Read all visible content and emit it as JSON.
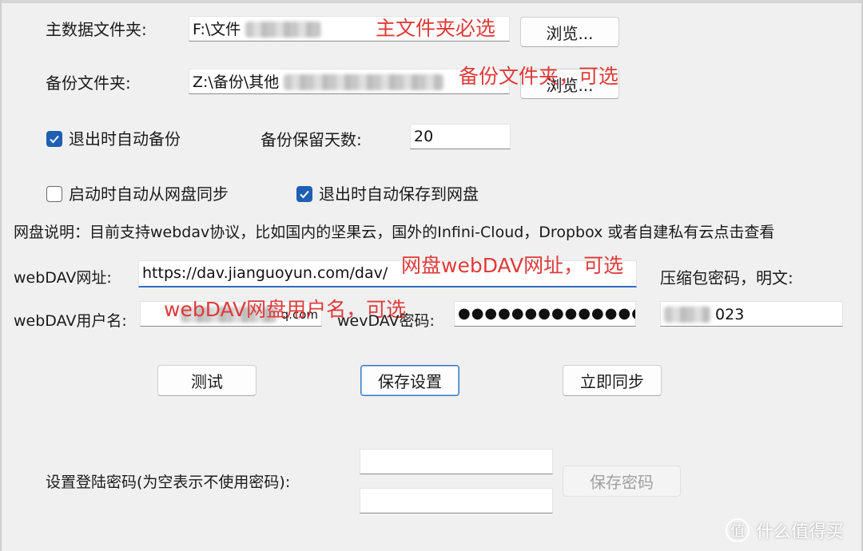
{
  "main_folder": {
    "label": "主数据文件夹:",
    "value_prefix": "F:\\文件",
    "browse_label": "浏览...",
    "annotation": "主文件夹必选"
  },
  "backup_folder": {
    "label": "备份文件夹:",
    "value_prefix": "Z:\\备份\\其他",
    "browse_label": "浏览...",
    "annotation": "备份文件夹，可选"
  },
  "auto_backup": {
    "label": "退出时自动备份",
    "checked": true
  },
  "retain_days": {
    "label": "备份保留天数:",
    "value": "20"
  },
  "sync_on_start": {
    "label": "启动时自动从网盘同步",
    "checked": false
  },
  "save_on_exit": {
    "label": "退出时自动保存到网盘",
    "checked": true
  },
  "cloud_note": "网盘说明：目前支持webdav协议，比如国内的坚果云，国外的Infini-Cloud，Dropbox 或者自建私有云点击查看",
  "webdav_url": {
    "label": "webDAV网址:",
    "value": "https://dav.jianguoyun.com/dav/",
    "annotation": "网盘webDAV网址，可选"
  },
  "zip_password": {
    "label": "压缩包密码，明文:",
    "value_suffix": "023"
  },
  "webdav_user": {
    "label": "webDAV用户名:",
    "value_suffix": "q.com",
    "annotation": "webDAV网盘用户名，可选"
  },
  "webdav_password": {
    "label": "wevDAV密码:",
    "masked": "●●●●●●●●●●●●●●●●"
  },
  "buttons": {
    "test": "测试",
    "save_settings": "保存设置",
    "sync_now": "立即同步"
  },
  "login_password": {
    "label": "设置登陆密码(为空表示不使用密码):",
    "save_label": "保存密码"
  },
  "watermark": {
    "logo": "值",
    "text": "什么值得买"
  },
  "colors": {
    "accent": "#1e5fb4",
    "annotation": "#e03a3a"
  }
}
